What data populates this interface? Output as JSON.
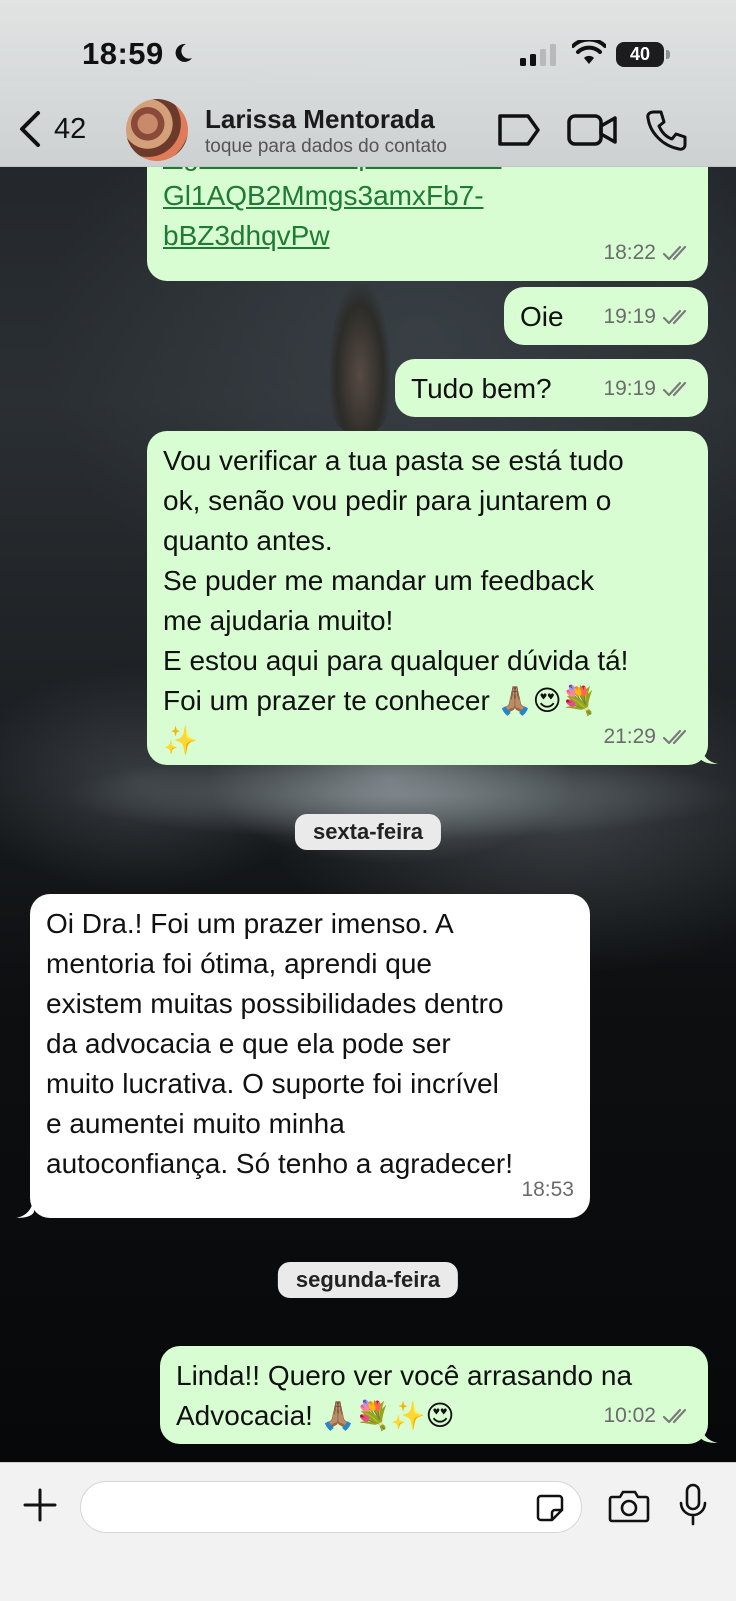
{
  "status_bar": {
    "time": "18:59",
    "battery": "40"
  },
  "header": {
    "back_count": "42",
    "contact_name": "Larissa Mentorada",
    "contact_subtitle": "toque para dados do contato"
  },
  "messages": [
    {
      "id": "m1",
      "direction": "outgoing",
      "lines": [
        "signature=OKzqSIlicFbCJI-",
        "Gl1AQB2Mmgs3amxFb7-",
        "bBZ3dhqvPw"
      ],
      "is_link": true,
      "time": "18:22",
      "read": true
    },
    {
      "id": "m2",
      "direction": "outgoing",
      "text": "Oie",
      "time": "19:19",
      "read": true
    },
    {
      "id": "m3",
      "direction": "outgoing",
      "text": "Tudo bem?",
      "time": "19:19",
      "read": true
    },
    {
      "id": "m4",
      "direction": "outgoing",
      "lines": [
        "Vou verificar a tua pasta se está tudo",
        "ok, senão vou pedir para juntarem o",
        "quanto antes.",
        "Se puder me mandar um feedback",
        "me ajudaria muito!",
        "E estou aqui para qualquer dúvida tá!",
        "Foi um prazer te conhecer 🙏🏽😍💐",
        "✨"
      ],
      "time": "21:29",
      "read": true
    },
    {
      "id": "m5",
      "direction": "incoming",
      "lines": [
        "Oi Dra.! Foi um prazer imenso. A",
        "mentoria foi ótima, aprendi que",
        "existem muitas  possibilidades dentro",
        "da advocacia e que ela pode ser",
        "muito lucrativa. O suporte foi incrível",
        "e aumentei muito minha",
        "autoconfiança. Só tenho a agradecer!"
      ],
      "time": "18:53"
    },
    {
      "id": "m6",
      "direction": "outgoing",
      "lines": [
        "Linda!! Quero ver você arrasando na",
        "Advocacia! 🙏🏽💐✨😍"
      ],
      "time": "10:02",
      "read": true
    }
  ],
  "date_separators": [
    "sexta-feira",
    "segunda-feira"
  ],
  "input": {
    "placeholder": ""
  },
  "colors": {
    "outgoing_bubble": "#d9fdd3",
    "incoming_bubble": "#ffffff",
    "link": "#1f7a33"
  }
}
